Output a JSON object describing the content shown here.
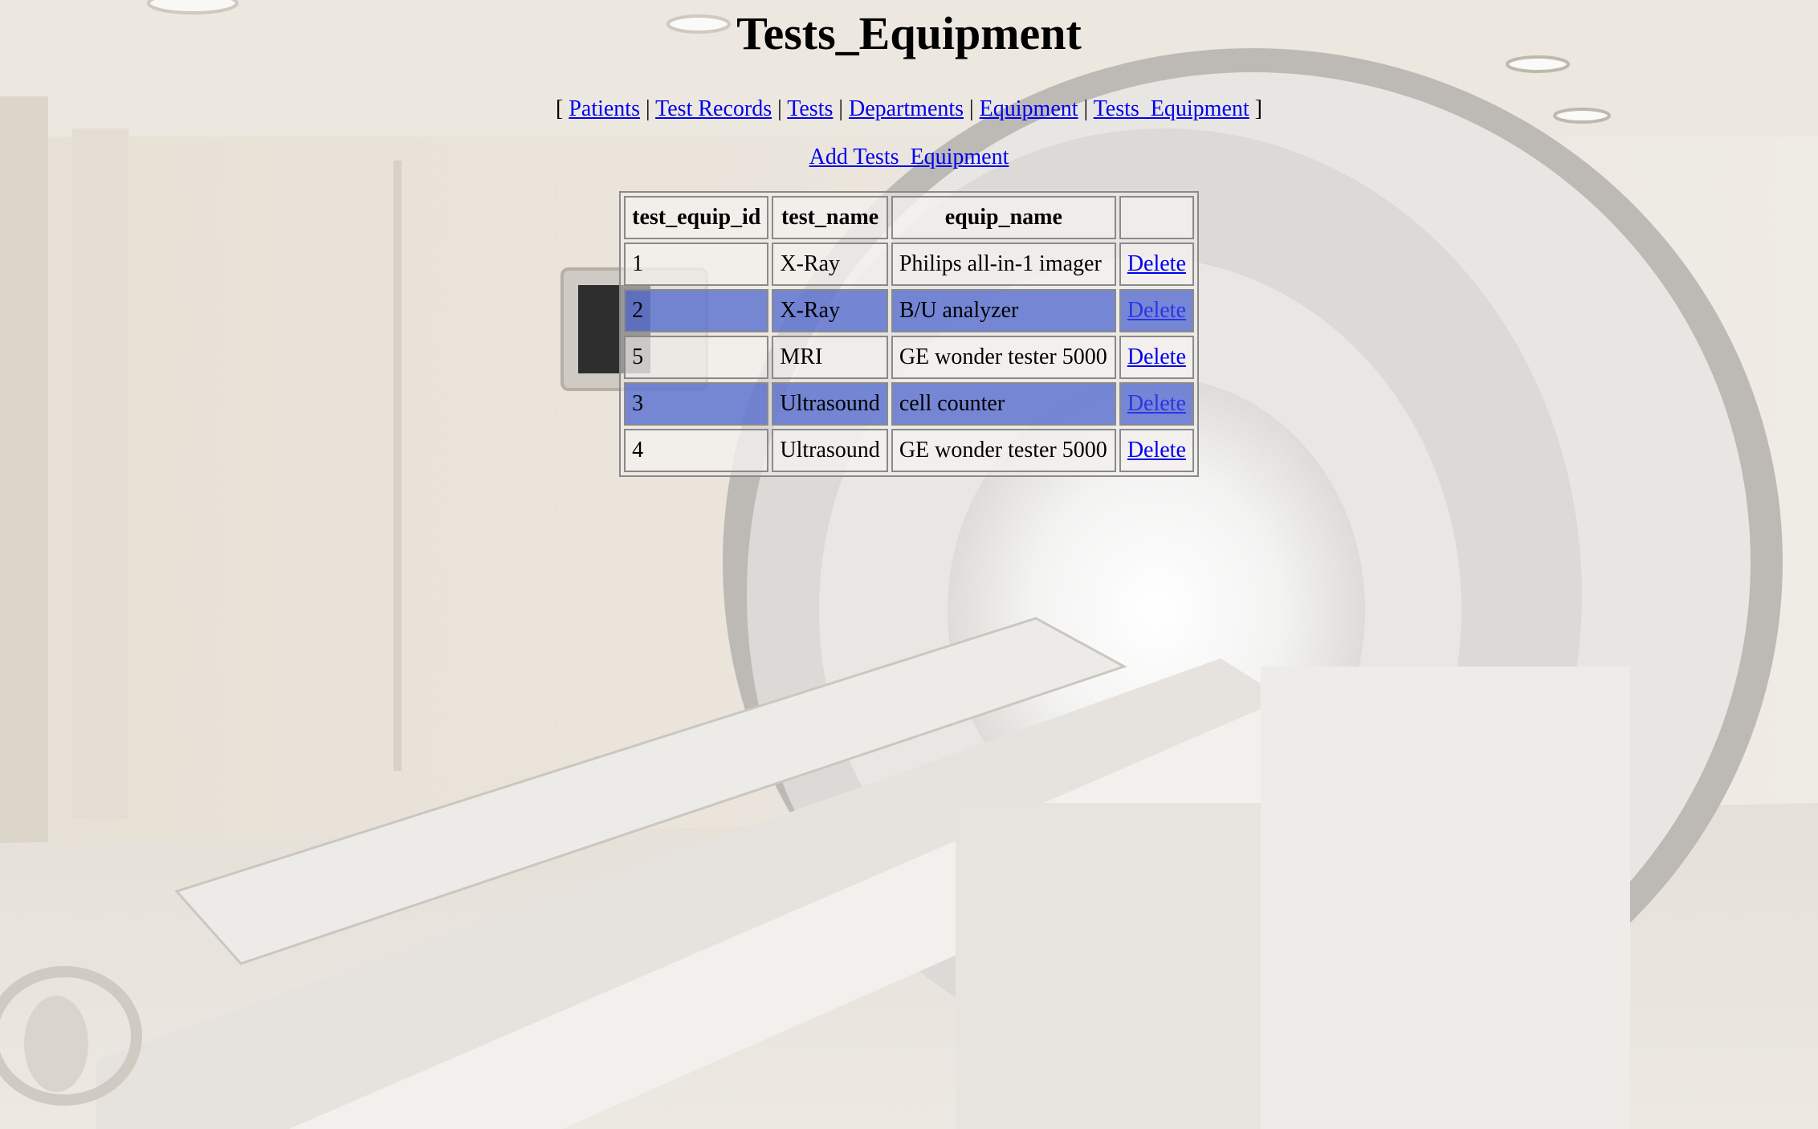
{
  "page": {
    "title": "Tests_Equipment"
  },
  "nav": {
    "open_bracket": "[",
    "close_bracket": "]",
    "separator": "|",
    "links": [
      {
        "label": "Patients"
      },
      {
        "label": "Test Records"
      },
      {
        "label": "Tests"
      },
      {
        "label": "Departments"
      },
      {
        "label": "Equipment"
      },
      {
        "label": "Tests_Equipment"
      }
    ]
  },
  "add_link": "Add Tests_Equipment",
  "table": {
    "headers": [
      "test_equip_id",
      "test_name",
      "equip_name",
      ""
    ],
    "rows": [
      {
        "id": "1",
        "test_name": "X-Ray",
        "equip_name": "Philips all-in-1 imager",
        "action": "Delete",
        "highlighted": false
      },
      {
        "id": "2",
        "test_name": "X-Ray",
        "equip_name": "B/U analyzer",
        "action": "Delete",
        "highlighted": true
      },
      {
        "id": "5",
        "test_name": "MRI",
        "equip_name": "GE wonder tester 5000",
        "action": "Delete",
        "highlighted": false
      },
      {
        "id": "3",
        "test_name": "Ultrasound",
        "equip_name": "cell counter",
        "action": "Delete",
        "highlighted": true
      },
      {
        "id": "4",
        "test_name": "Ultrasound",
        "equip_name": "GE wonder tester 5000",
        "action": "Delete",
        "highlighted": false
      }
    ]
  },
  "colors": {
    "link": "#0000ee",
    "row_highlight": "#465fcd",
    "border": "#8a8a8a"
  }
}
